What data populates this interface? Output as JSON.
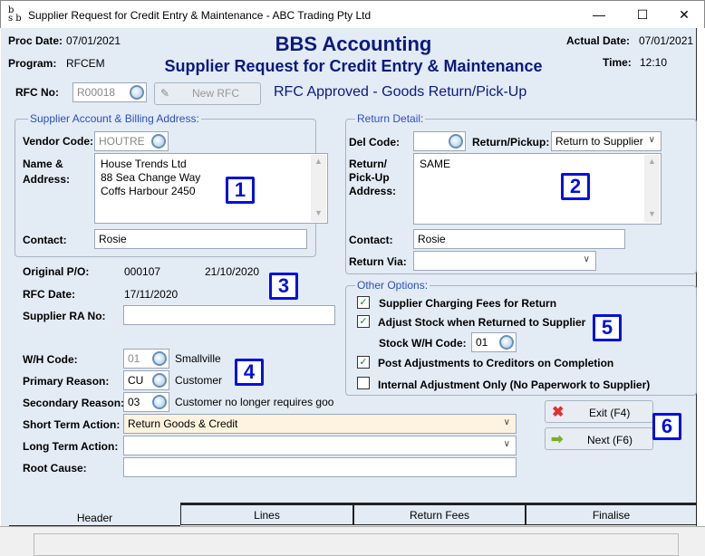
{
  "window": {
    "title": "Supplier Request for Credit Entry & Maintenance - ABC Trading Pty Ltd",
    "logo": "bsb",
    "minimize": "—",
    "maximize": "☐",
    "close": "✕"
  },
  "header": {
    "proc_date_label": "Proc Date:",
    "proc_date": "07/01/2021",
    "program_label": "Program:",
    "program": "RFCEM",
    "app_title": "BBS Accounting",
    "subtitle": "Supplier Request for Credit Entry & Maintenance",
    "actual_date_label": "Actual Date:",
    "actual_date": "07/01/2021",
    "time_label": "Time:",
    "time": "12:10",
    "rfc_no_label": "RFC No:",
    "rfc_no": "R00018",
    "new_rfc": "New RFC",
    "status": "RFC Approved - Goods Return/Pick-Up"
  },
  "supplier": {
    "group": "Supplier Account & Billing Address:",
    "vendor_label": "Vendor Code:",
    "vendor": "HOUTRE",
    "name_label": "Name &",
    "name_label2": "Address:",
    "address": [
      "House Trends Ltd",
      "88 Sea Change Way",
      "Coffs Harbour 2450"
    ],
    "contact_label": "Contact:",
    "contact": "Rosie"
  },
  "return_detail": {
    "group": "Return Detail:",
    "del_code_label": "Del Code:",
    "del_code": "",
    "return_pickup_label": "Return/Pickup:",
    "return_pickup": "Return to Supplier",
    "address_label": [
      "Return/",
      "Pick-Up",
      "Address:"
    ],
    "address": "SAME",
    "contact_label": "Contact:",
    "contact": "Rosie",
    "return_via_label": "Return Via:",
    "return_via": ""
  },
  "po": {
    "original_po_label": "Original P/O:",
    "original_po": "000107",
    "po_date": "21/10/2020",
    "rfc_date_label": "RFC Date:",
    "rfc_date": "17/11/2020",
    "supplier_ra_label": "Supplier RA No:",
    "supplier_ra": ""
  },
  "codes": {
    "wh_label": "W/H Code:",
    "wh": "01",
    "wh_name": "Smallville",
    "primary_label": "Primary Reason:",
    "primary": "CU",
    "primary_name": "Customer",
    "secondary_label": "Secondary Reason:",
    "secondary": "03",
    "secondary_name": "Customer no longer requires goo",
    "short_label": "Short Term Action:",
    "short": "Return Goods & Credit",
    "long_label": "Long Term Action:",
    "long": "",
    "root_label": "Root Cause:",
    "root": ""
  },
  "options": {
    "group": "Other Options:",
    "items": [
      {
        "label": "Supplier Charging Fees for Return",
        "checked": true
      },
      {
        "label": "Adjust Stock when Returned to Supplier",
        "checked": true
      },
      {
        "label": "Post Adjustments to Creditors on Completion",
        "checked": true
      },
      {
        "label": "Internal Adjustment Only (No Paperwork to Supplier)",
        "checked": false
      }
    ],
    "stock_wh_label": "Stock W/H Code:",
    "stock_wh": "01"
  },
  "buttons": {
    "exit": "Exit (F4)",
    "next": "Next (F6)"
  },
  "badges": [
    "1",
    "2",
    "3",
    "4",
    "5",
    "6"
  ],
  "tabs": [
    "Header",
    "Lines",
    "Return Fees",
    "Finalise"
  ],
  "check": "✓",
  "colors": {
    "accent": "#0a1a80",
    "badge": "#0010e0",
    "background": "#e3ebf5",
    "short_term_field": "#fdf3df"
  }
}
